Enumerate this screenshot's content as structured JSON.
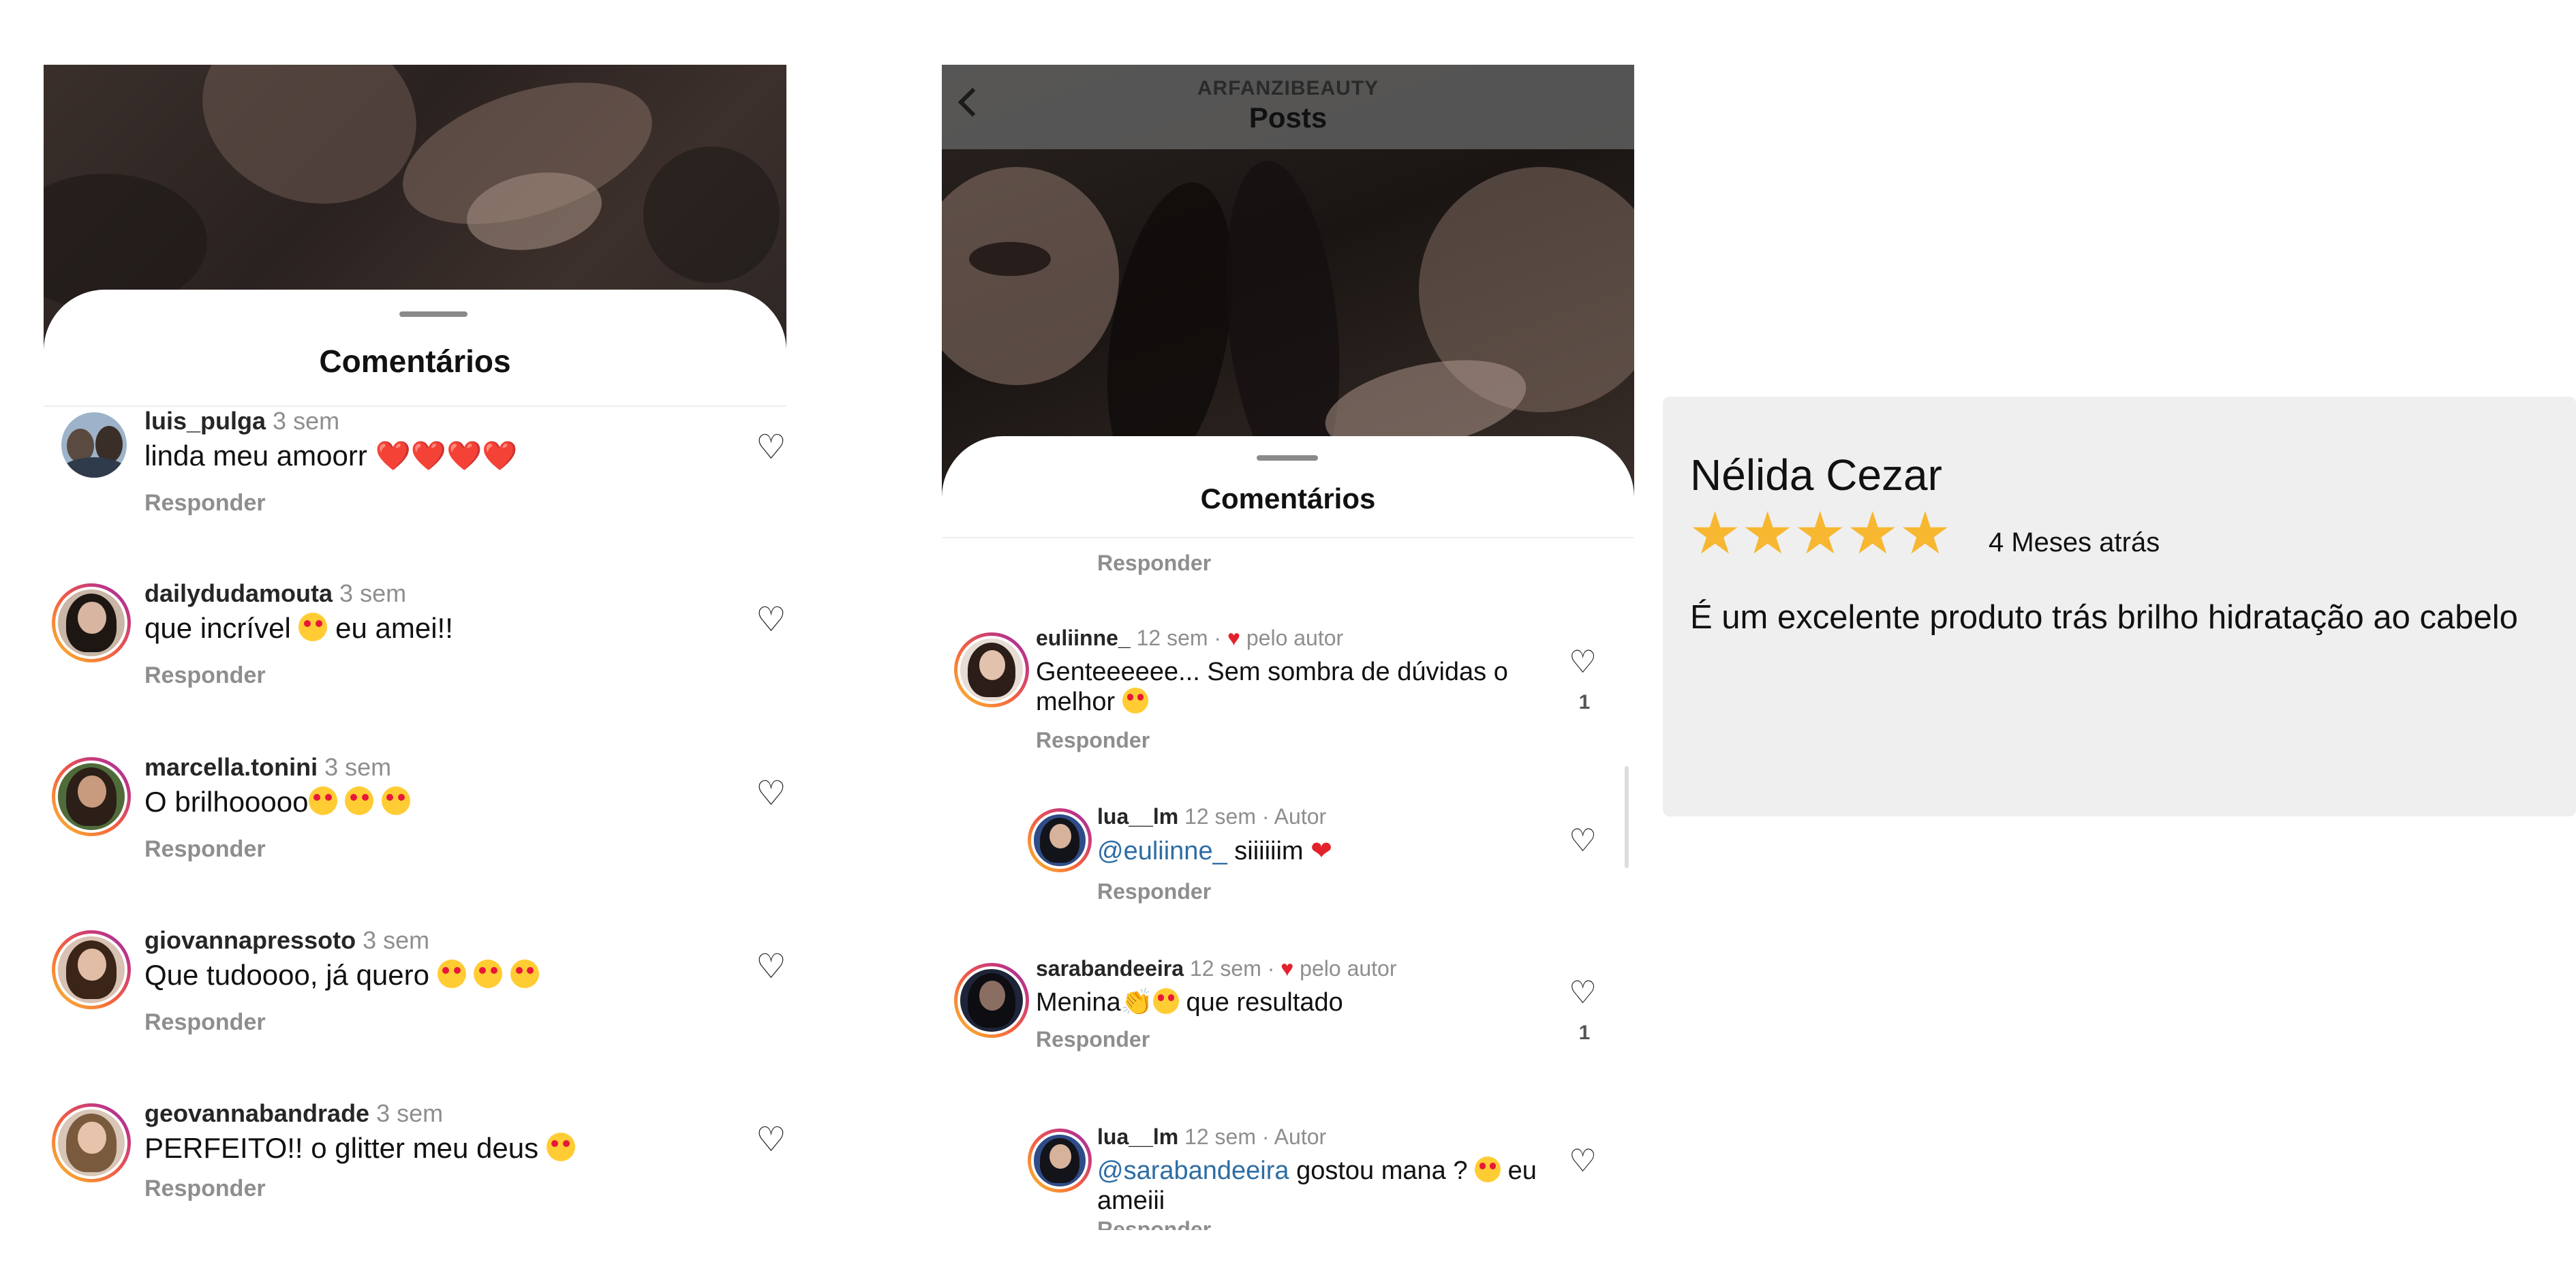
{
  "panel_left": {
    "sheet_title": "Comentários",
    "comments": [
      {
        "user": "luis_pulga",
        "time": "3 sem",
        "text": "linda meu amoorr ",
        "emoji": "❤️❤️❤️❤️",
        "reply": "Responder"
      },
      {
        "user": "dailydudamouta",
        "time": "3 sem",
        "text": "que incrível ",
        "text_after": " eu amei!!",
        "reply": "Responder"
      },
      {
        "user": "marcella.tonini",
        "time": "3 sem",
        "text": "O brilhooooo",
        "reply": "Responder"
      },
      {
        "user": "giovannapressoto",
        "time": "3 sem",
        "text": "Que tudoooo, já quero ",
        "reply": "Responder"
      },
      {
        "user": "geovannabandrade",
        "time": "3 sem",
        "text": "PERFEITO!! o glitter meu deus ",
        "reply": "Responder"
      }
    ]
  },
  "panel_middle": {
    "header_account": "ARFANZIBEAUTY",
    "header_title": "Posts",
    "back_icon": "chevron-left-icon",
    "sheet_title": "Comentários",
    "top_reply": "Responder",
    "comments": [
      {
        "user": "euliinne_",
        "time": "12 sem ·",
        "badge": "pelo autor",
        "text_line1": "Genteeeeee... Sem sombra de dúvidas o",
        "text_line2": "melhor ",
        "reply": "Responder",
        "likes": "1"
      },
      {
        "user": "lua__lm",
        "time": "12 sem · Autor",
        "mention": "@euliinne_",
        "text": " siiiiiim ",
        "reply": "Responder"
      },
      {
        "user": "sarabandeeira",
        "time": "12 sem ·",
        "badge": "pelo autor",
        "text": "Menina",
        "text_after": " que resultado",
        "reply": "Responder",
        "likes": "1"
      },
      {
        "user": "lua__lm",
        "time": "12 sem · Autor",
        "mention": "@sarabandeeira",
        "text_line1": " gostou mana ? ",
        "text_line1_after": " eu",
        "text_line2": "ameiii",
        "reply": "Responder"
      }
    ]
  },
  "review": {
    "name": "Nélida Cezar",
    "stars": 5,
    "stars_glyphs": "★★★★★",
    "ago": "4 Meses atrás",
    "text": "É um excelente produto trás brilho hidratação ao cabelo",
    "star_color": "#f7b731"
  },
  "colors": {
    "mention": "#2e6da4",
    "heart_red": "#e3212c",
    "muted": "#8e8e8e",
    "review_bg": "#efefef"
  }
}
